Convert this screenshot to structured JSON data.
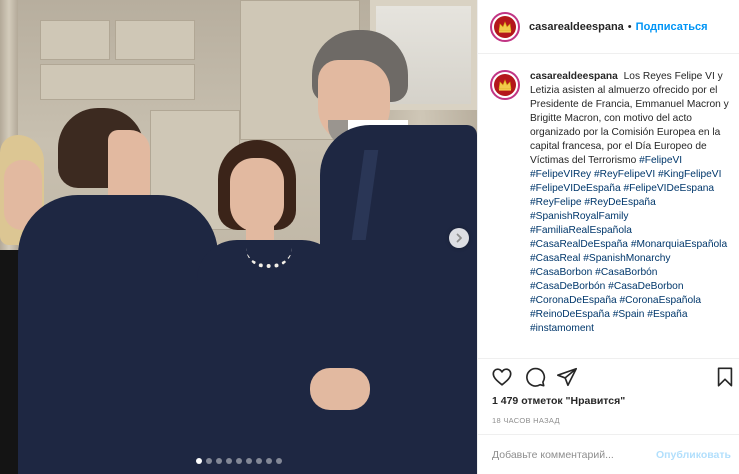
{
  "post": {
    "username": "casarealdeespana",
    "separator": "•",
    "follow_label": "Подписаться",
    "caption": {
      "username": "casarealdeespana",
      "text": "Los Reyes Felipe VI y Letizia asisten al almuerzo ofrecido por el Presidente de Francia, Emmanuel Macron y Brigitte Macron, con motivo del acto organizado por la Comisión Europea en la capital francesa, por el Día Europeo de Víctimas del Terrorismo",
      "hashtags": [
        "#FelipeVI",
        "#FelipeVIRey",
        "#ReyFelipeVI",
        "#KingFelipeVI",
        "#FelipeVIDeEspaña",
        "#FelipeVIDeEspana",
        "#ReyFelipe",
        "#ReyDeEspaña",
        "#SpanishRoyalFamily",
        "#FamiliaRealEspañola",
        "#CasaRealDeEspaña",
        "#MonarquiaEspañola",
        "#CasaReal",
        "#SpanishMonarchy",
        "#CasaBorbon",
        "#CasaBorbón",
        "#CasaDeBorbón",
        "#CasaDeBorbon",
        "#CoronaDeEspaña",
        "#CoronaEspañola",
        "#ReinoDeEspaña",
        "#Spain",
        "#España",
        "#instamoment"
      ]
    },
    "likes_text": "1 479 отметок \"Нравится\"",
    "timestamp": "18 ЧАСОВ НАЗАД",
    "comment": {
      "placeholder": "Добавьте комментарий...",
      "value": "",
      "publish_label": "Опубликовать"
    },
    "carousel": {
      "total": 9,
      "active": 0
    }
  },
  "icons": {
    "like": "heart-icon",
    "comment": "comment-icon",
    "share": "share-icon",
    "save": "bookmark-icon",
    "next": "chevron-right-icon"
  },
  "colors": {
    "accent": "#0095f6",
    "hashtag": "#00376b",
    "avatar_ring": "#c13584",
    "avatar_fill": "#b4171b"
  }
}
